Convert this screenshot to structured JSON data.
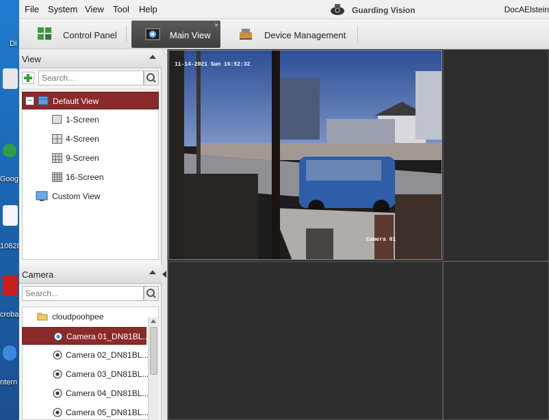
{
  "menubar": {
    "items": [
      "File",
      "System",
      "View",
      "Tool",
      "Help"
    ],
    "app_title": "Guarding Vision",
    "user": "DocAElstein"
  },
  "tabs": [
    {
      "label": "Control Panel",
      "icon": "grid-icon"
    },
    {
      "label": "Main View",
      "icon": "camera-view-icon",
      "close": "×"
    },
    {
      "label": "Device Management",
      "icon": "device-icon"
    }
  ],
  "desktop": {
    "labels": [
      "Di",
      "Goog",
      "10828",
      "crobat",
      "ntern"
    ]
  },
  "view_panel": {
    "title": "View",
    "search_placeholder": "Search...",
    "tree": [
      {
        "label": "Default View",
        "selected": true,
        "expand": "−"
      },
      {
        "label": "1-Screen"
      },
      {
        "label": "4-Screen"
      },
      {
        "label": "9-Screen"
      },
      {
        "label": "16-Screen"
      },
      {
        "label": "Custom View"
      }
    ]
  },
  "camera_panel": {
    "title": "Camera",
    "search_placeholder": "Search...",
    "group": "cloudpoohpee",
    "cameras": [
      {
        "label": "Camera 01_DN81BL...",
        "selected": true
      },
      {
        "label": "Camera 02_DN81BL..."
      },
      {
        "label": "Camera 03_DN81BL..."
      },
      {
        "label": "Camera 04_DN81BL..."
      },
      {
        "label": "Camera 05_DN81BL..."
      }
    ]
  },
  "video": {
    "timestamp": "11-14-2021 Sun 16:52:32",
    "camera_label": "Camera 01"
  },
  "colors": {
    "selected_row": "#8b2a2a",
    "grid_bg": "#2d2d2d",
    "active_tab": "#4a4a4a"
  }
}
